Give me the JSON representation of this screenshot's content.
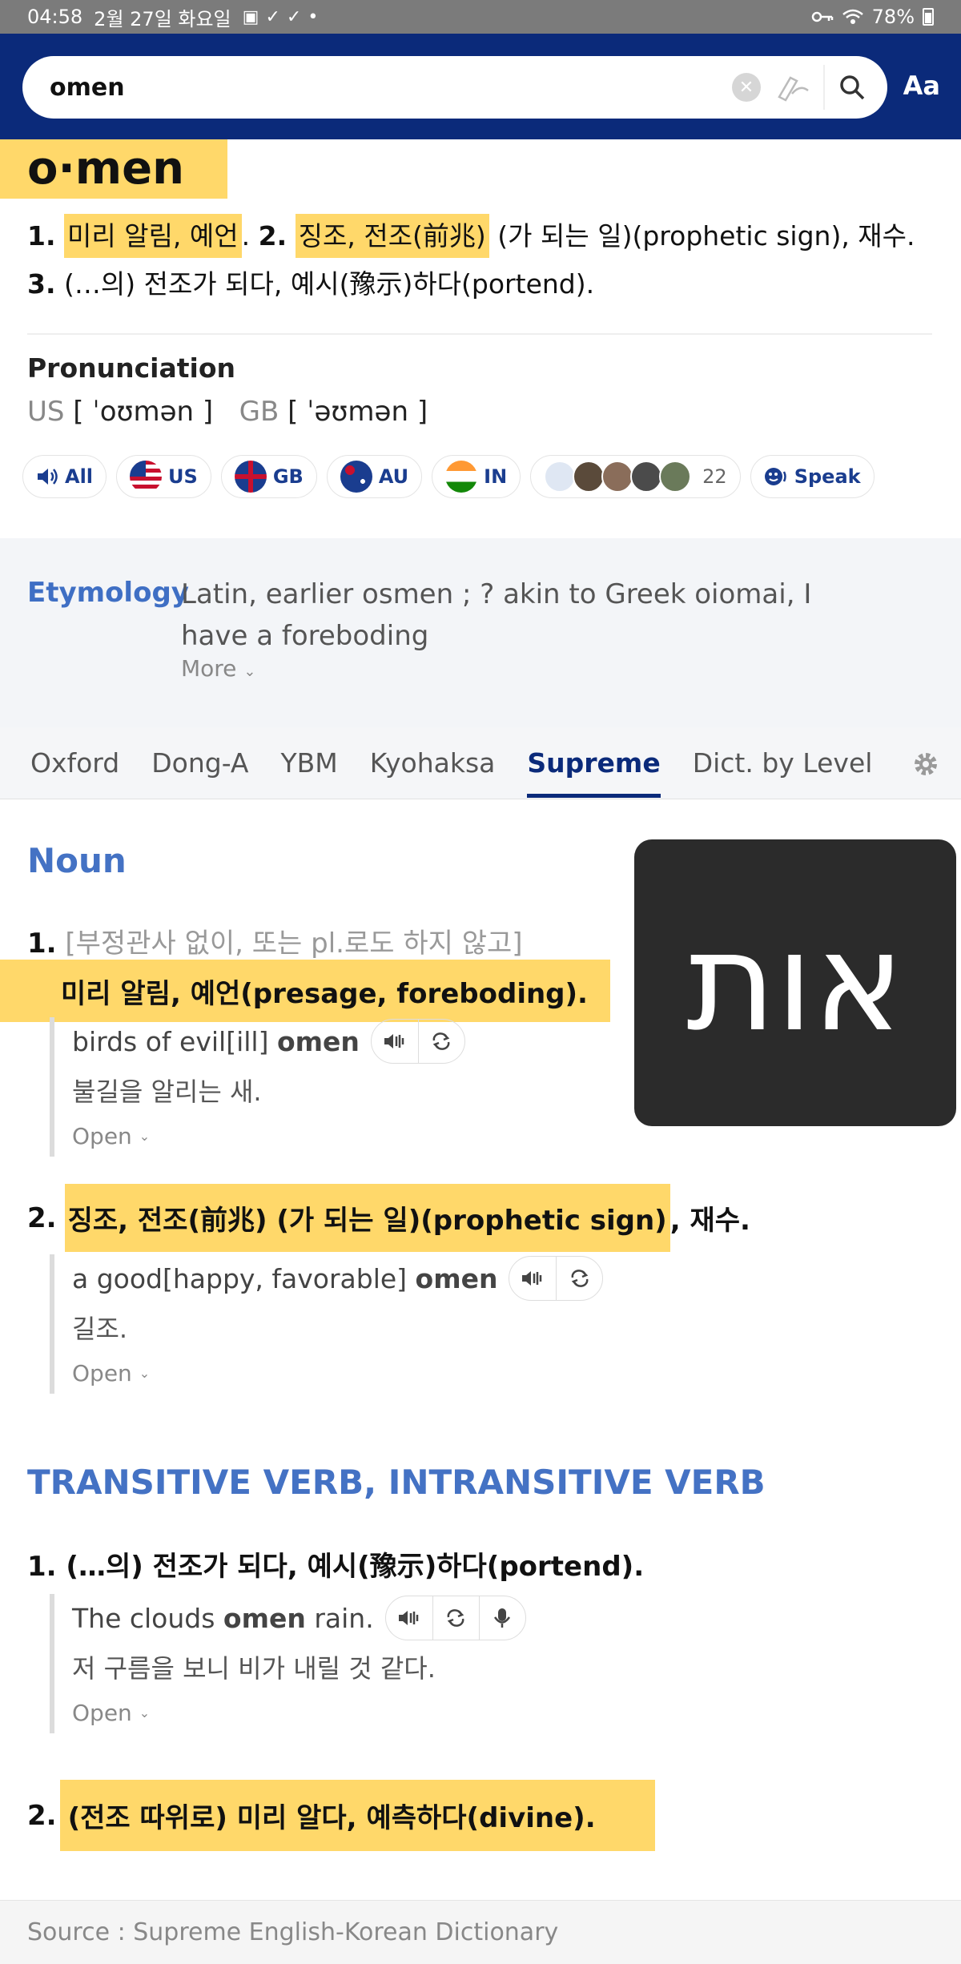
{
  "status_bar": {
    "time": "04:58",
    "date": "2월 27일 화요일",
    "battery": "78%"
  },
  "search": {
    "query": "omen",
    "font_button": "Aa"
  },
  "entry": {
    "headword": "o·men",
    "summary": {
      "n1": "1.",
      "d1": "미리 알림, 예언",
      "p1": ".",
      "n2": "2.",
      "d2": "징조, 전조(前兆)",
      "d2rest": " (가 되는 일)(prophetic sign), 재수.",
      "n3": "3.",
      "d3": " (…의) 전조가 되다, 예시(豫示)하다(portend)."
    },
    "pronunciation": {
      "title": "Pronunciation",
      "us_label": "US",
      "us": "[ ˈoʊmən ]",
      "gb_label": "GB",
      "gb": "[ ˈəʊmən ]"
    },
    "audio_chips": {
      "all": "All",
      "us": "US",
      "gb": "GB",
      "au": "AU",
      "in": "IN",
      "count": "22",
      "speak": "Speak"
    },
    "etymology": {
      "title": "Etymology",
      "text": "Latin, earlier osmen ; ? akin to Greek oiomai, I have a foreboding",
      "more": "More"
    }
  },
  "tabs": [
    "Oxford",
    "Dong-A",
    "YBM",
    "Kyohaksa",
    "Supreme",
    "Dict. by Level"
  ],
  "active_tab": "Supreme",
  "noun": {
    "title": "Noun",
    "s1_num": "1.",
    "s1_label": "[부정관사 없이, 또는 pl.로도 하지 않고]",
    "s1_def": "미리 알림, 예언(presage, foreboding).",
    "s1_ex_en_pre": "birds of evil[ill] ",
    "s1_ex_en_bold": "omen",
    "s1_ex_ko": "불길을 알리는 새.",
    "s2_num": "2.",
    "s2_def": "징조, 전조(前兆) (가 되는 일)(prophetic sign)",
    "s2_rest": ", 재수.",
    "s2_ex_en_pre": "a good[happy, favorable] ",
    "s2_ex_en_bold": "omen",
    "s2_ex_ko": "길조.",
    "open": "Open"
  },
  "verb": {
    "title": "TRANSITIVE VERB, INTRANSITIVE VERB",
    "s1": "1. (…의) 전조가 되다, 예시(豫示)하다(portend).",
    "s1_ex_pre": "The clouds ",
    "s1_ex_bold": "omen",
    "s1_ex_post": " rain.",
    "s1_ex_ko": "저 구름을 보니 비가 내릴 것 같다.",
    "s2_num": "2.",
    "s2_def": "(전조 따위로) 미리 알다, 예측하다(divine).",
    "open": "Open"
  },
  "image_text": "אות",
  "footer": "Source : Supreme English-Korean Dictionary",
  "colors": {
    "header": "#0b2a7a",
    "highlight": "#ffd86a",
    "pos_title": "#4472c4"
  }
}
